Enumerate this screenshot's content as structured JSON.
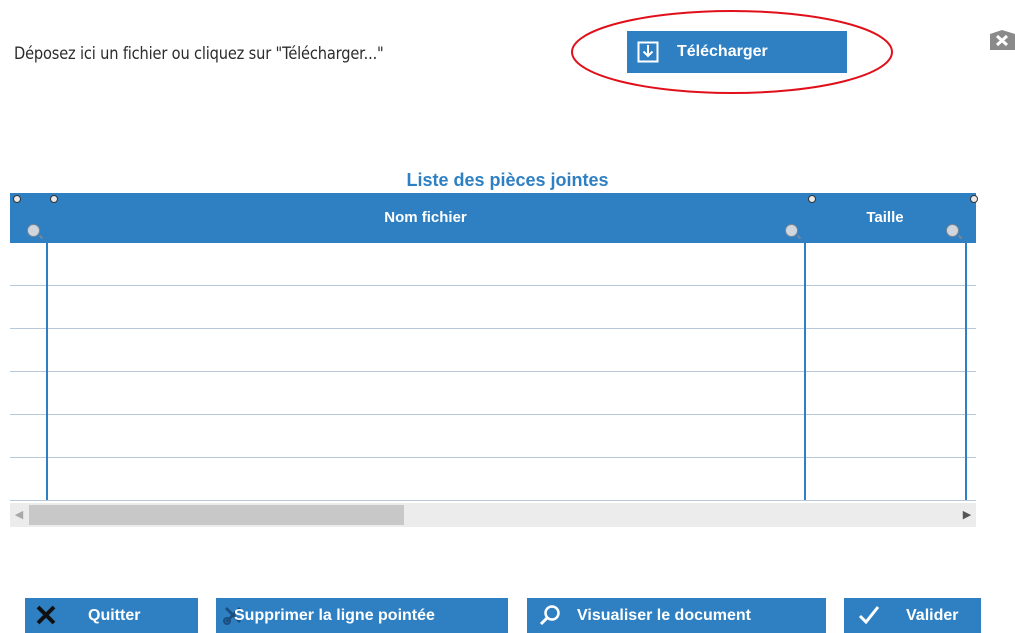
{
  "upload": {
    "instruction": "Déposez ici un fichier ou cliquez sur \"Télécharger...\"",
    "button_label": "Télécharger",
    "highlight_color": "#e0101a"
  },
  "attachments": {
    "title": "Liste des pièces jointes",
    "columns": [
      {
        "label": ""
      },
      {
        "label": "Nom fichier"
      },
      {
        "label": "Taille"
      }
    ],
    "rows": [
      [
        "",
        "",
        ""
      ],
      [
        "",
        "",
        ""
      ],
      [
        "",
        "",
        ""
      ],
      [
        "",
        "",
        ""
      ],
      [
        "",
        "",
        ""
      ],
      [
        "",
        "",
        ""
      ]
    ]
  },
  "actions": {
    "quit_label": "Quitter",
    "delete_label": "Supprimer la ligne pointée",
    "view_label": "Visualiser le document",
    "validate_label": "Valider"
  },
  "theme": {
    "accent": "#2f80c3",
    "grid_line": "#b7c8db"
  },
  "icons": {
    "upload": "download-arrow-box-icon",
    "close": "close-icon",
    "quit": "x-icon",
    "delete": "scissor-x-icon",
    "view": "magnifier-icon",
    "validate": "checkmark-icon"
  }
}
